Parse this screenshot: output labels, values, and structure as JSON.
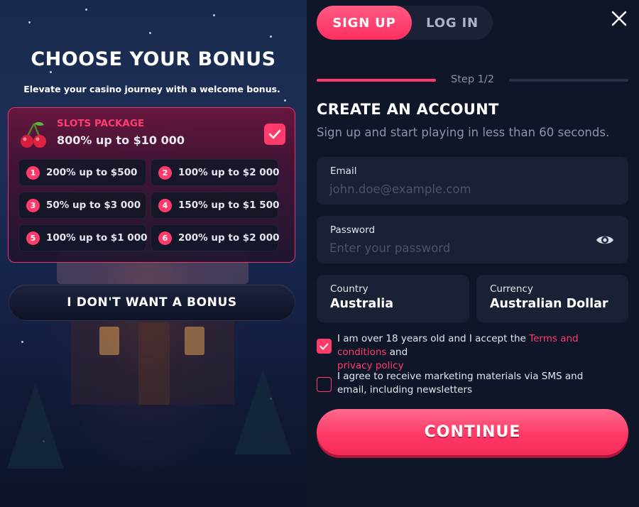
{
  "bonus_panel": {
    "title": "CHOOSE YOUR BONUS",
    "subtitle": "Elevate your casino journey with a welcome bonus.",
    "package": {
      "name": "SLOTS PACKAGE",
      "amount": "800% up to $10 000",
      "selected": true,
      "icon": "cherry-icon"
    },
    "options": [
      {
        "num": "1",
        "text": "200% up to $500"
      },
      {
        "num": "2",
        "text": "100% up to $2 000"
      },
      {
        "num": "3",
        "text": "50% up to $3 000"
      },
      {
        "num": "4",
        "text": "150% up to $1 500"
      },
      {
        "num": "5",
        "text": "100% up to $1 000"
      },
      {
        "num": "6",
        "text": "200% up to $2 000"
      }
    ],
    "no_bonus_label": "I DON'T WANT A BONUS"
  },
  "tabs": {
    "signup": "SIGN UP",
    "login": "LOG IN",
    "active": "signup"
  },
  "step": {
    "label": "Step 1/2",
    "current": 1,
    "total": 2
  },
  "form": {
    "title": "CREATE AN ACCOUNT",
    "subtitle": "Sign up and start playing in less than 60 seconds.",
    "email": {
      "label": "Email",
      "placeholder": "john.doe@example.com",
      "value": ""
    },
    "password": {
      "label": "Password",
      "placeholder": "Enter your password",
      "value": ""
    },
    "country": {
      "label": "Country",
      "value": "Australia"
    },
    "currency": {
      "label": "Currency",
      "value": "Australian Dollar"
    },
    "consent_age": {
      "checked": true,
      "text_before": "I am over 18 years old and I accept the ",
      "terms_link": "Terms and conditions",
      "text_and": " and",
      "privacy_link": "privacy policy"
    },
    "consent_marketing": {
      "checked": false,
      "text": "I agree to receive marketing materials via SMS and email, including newsletters"
    },
    "continue_label": "CONTINUE"
  },
  "colors": {
    "accent": "#ff3b6b",
    "panel_bg": "#0f1628",
    "field_bg": "#1a2134"
  }
}
